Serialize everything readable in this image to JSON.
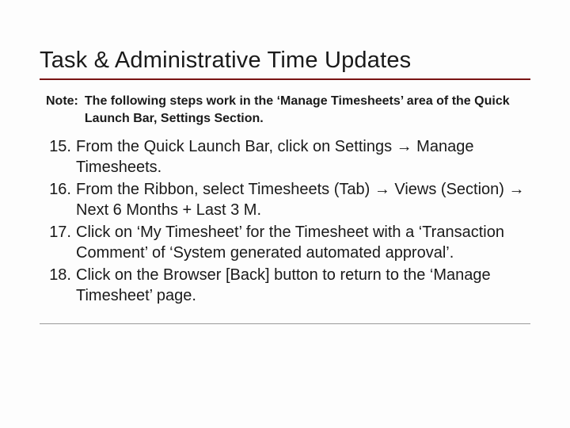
{
  "title": "Task & Administrative Time Updates",
  "note": {
    "label": "Note:",
    "text": "The following steps work in the ‘Manage Timesheets’ area of the Quick Launch Bar, Settings Section."
  },
  "arrow": "→",
  "steps": [
    {
      "n": "15.",
      "text": "From the Quick Launch Bar, click on Settings → Manage Timesheets."
    },
    {
      "n": "16.",
      "text": "From the Ribbon, select Timesheets (Tab) → Views (Section) → Next 6 Months + Last 3 M."
    },
    {
      "n": "17.",
      "text": "Click on ‘My Timesheet’ for the Timesheet with a ‘Transaction Comment’ of ‘System generated automated approval’."
    },
    {
      "n": "18.",
      "text": "Click on the Browser [Back] button to return to the ‘Manage Timesheet’ page."
    }
  ]
}
